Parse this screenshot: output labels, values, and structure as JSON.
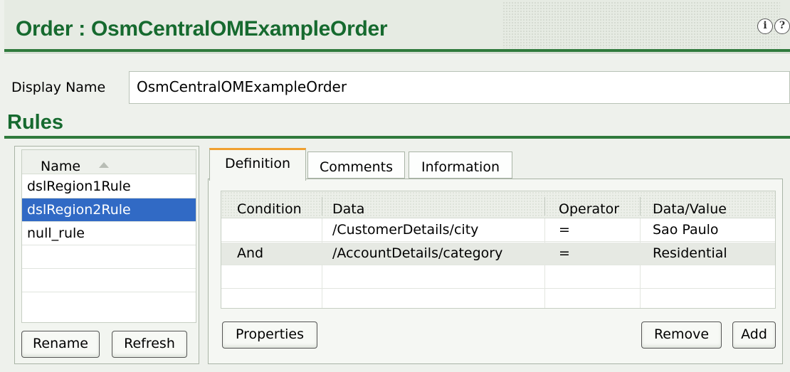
{
  "header": {
    "title": "Order : OsmCentralOMExampleOrder",
    "info_icon_glyph": "i",
    "help_icon_glyph": "?"
  },
  "display_name": {
    "label": "Display Name",
    "value": "OsmCentralOMExampleOrder"
  },
  "rules": {
    "section_title": "Rules",
    "list": {
      "column_header": "Name",
      "items": [
        {
          "label": "dslRegion1Rule",
          "selected": false
        },
        {
          "label": "dslRegion2Rule",
          "selected": true
        },
        {
          "label": "null_rule",
          "selected": false
        }
      ]
    },
    "buttons": {
      "rename": "Rename",
      "refresh": "Refresh"
    },
    "tabs": [
      {
        "label": "Definition",
        "active": true
      },
      {
        "label": "Comments",
        "active": false
      },
      {
        "label": "Information",
        "active": false
      }
    ],
    "grid": {
      "columns": [
        "Condition",
        "Data",
        "Operator",
        "Data/Value"
      ],
      "rows": [
        {
          "condition": "",
          "data": "/CustomerDetails/city",
          "operator": "=",
          "value": "Sao Paulo"
        },
        {
          "condition": "And",
          "data": "/AccountDetails/category",
          "operator": "=",
          "value": "Residential"
        }
      ]
    },
    "definition_buttons": {
      "properties": "Properties",
      "remove": "Remove",
      "add": "Add"
    }
  },
  "colors": {
    "title_green": "#166a2f",
    "rule_green": "#2f7a3c",
    "selection_blue": "#316ac5",
    "active_tab_accent": "#f0a030"
  }
}
